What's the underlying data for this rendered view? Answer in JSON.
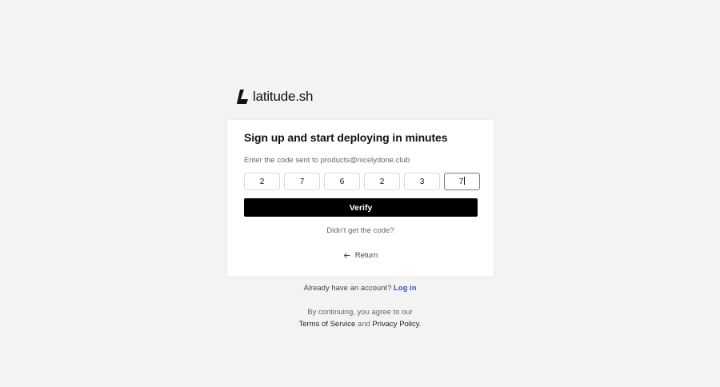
{
  "brand": {
    "name": "latitude.sh"
  },
  "card": {
    "title": "Sign up and start deploying in minutes",
    "subtitle": "Enter the code sent to products@nicelydone.club",
    "code_digits": [
      "2",
      "7",
      "6",
      "2",
      "3",
      "7"
    ],
    "verify_label": "Verify",
    "resend_text": "Didn't get the code?",
    "return_label": "Return"
  },
  "footer": {
    "already_text": "Already have an account?",
    "login_label": "Log in",
    "agree_text": "By continuing, you agree to our",
    "terms_label": "Terms of Service",
    "and_text": "and",
    "privacy_label": "Privacy Policy",
    "period": "."
  },
  "colors": {
    "accent": "#3b4fc7",
    "button": "#000000",
    "background": "#f3f3f3"
  }
}
